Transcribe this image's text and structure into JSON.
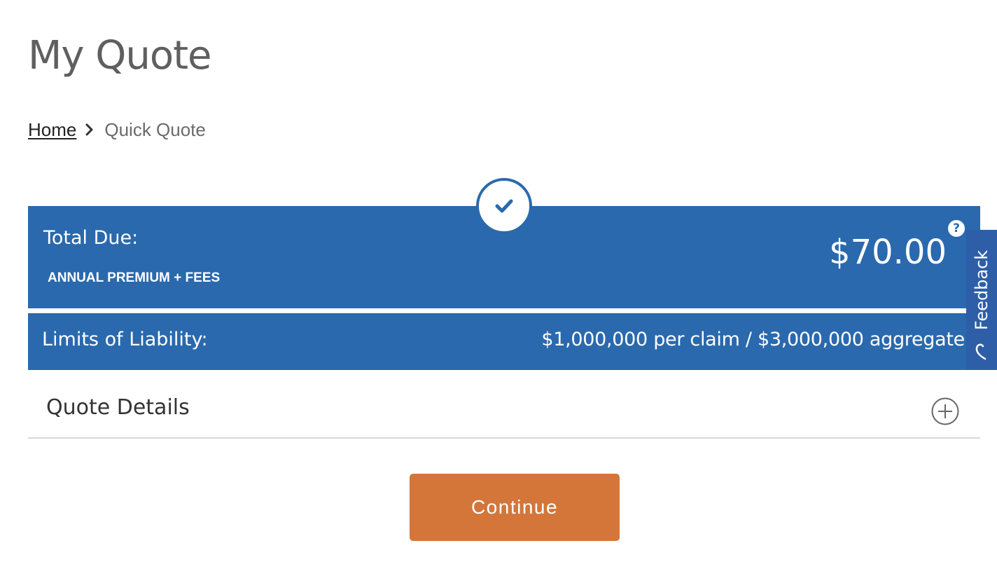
{
  "header": {
    "title": "My Quote"
  },
  "breadcrumb": {
    "home_label": "Home",
    "current_label": "Quick Quote"
  },
  "total": {
    "label": "Total Due:",
    "sublabel": "ANNUAL PREMIUM + FEES",
    "amount": "$70.00",
    "help_icon": "?"
  },
  "limits": {
    "label": "Limits of Liability:",
    "value": "$1,000,000 per claim / $3,000,000 aggregate"
  },
  "details": {
    "label": "Quote Details",
    "expanded": false
  },
  "actions": {
    "continue_label": "Continue"
  },
  "feedback": {
    "label": "Feedback"
  },
  "icons": {
    "breadcrumb_separator": "chevron-right-icon",
    "status": "checkmark-icon",
    "help": "question-icon",
    "expand": "plus-circle-icon",
    "feedback": "feedback-heart-icon"
  },
  "colors": {
    "panel_blue": "#2a69ad",
    "button_orange": "#d4763a",
    "feedback_blue": "#2f5ea8",
    "title_gray": "#5f5f5f"
  }
}
